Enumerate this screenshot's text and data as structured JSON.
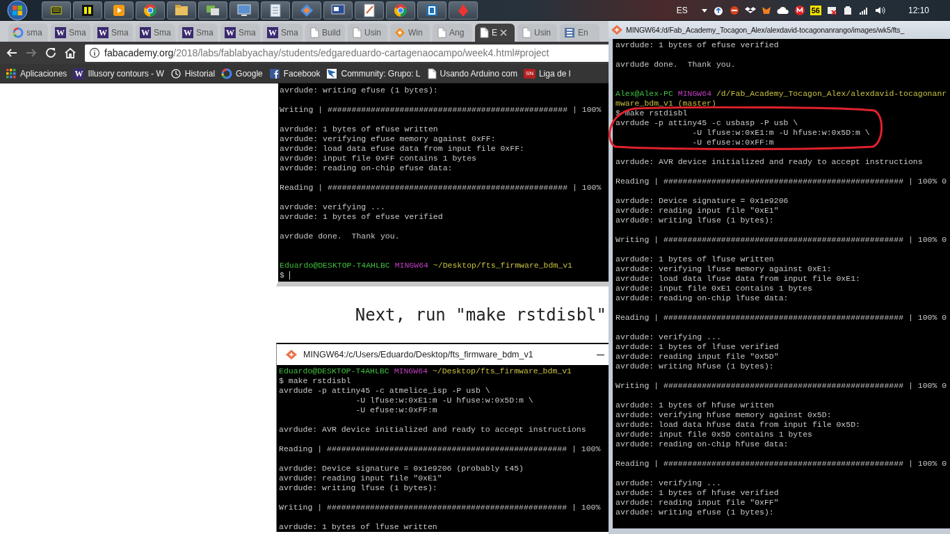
{
  "taskbar": {
    "language": "ES",
    "badge": "56",
    "clock": "12:10"
  },
  "browser": {
    "tabs": [
      {
        "kind": "google",
        "label": "sma",
        "selected": false
      },
      {
        "kind": "wiki",
        "icon_text": "W",
        "label": "Sma",
        "selected": false
      },
      {
        "kind": "wiki",
        "icon_text": "W",
        "label": "Sma",
        "selected": false
      },
      {
        "kind": "wiki",
        "icon_text": "W",
        "label": "Sma",
        "selected": false
      },
      {
        "kind": "wiki",
        "icon_text": "W",
        "label": "Sma",
        "selected": false
      },
      {
        "kind": "wiki",
        "icon_text": "W",
        "label": "Sma",
        "selected": false
      },
      {
        "kind": "wiki",
        "icon_text": "W",
        "label": "Sma",
        "selected": false
      },
      {
        "kind": "doc",
        "label": "Build",
        "selected": false
      },
      {
        "kind": "doc",
        "label": "Usin",
        "selected": false
      },
      {
        "kind": "diamond",
        "label": "Win",
        "selected": false
      },
      {
        "kind": "doc",
        "label": "Ang",
        "selected": false
      },
      {
        "kind": "doc",
        "label": "E",
        "selected": true
      },
      {
        "kind": "doc",
        "label": "Usin",
        "selected": false
      },
      {
        "kind": "lines",
        "label": "En",
        "selected": false
      }
    ],
    "address": {
      "host": "fabacademy.org",
      "path": "/2018/labs/fablabyachay/students/edgareduardo-cartagenaocampo/week4.html#project"
    },
    "bookmarks": [
      {
        "kind": "apps",
        "label": "Aplicaciones"
      },
      {
        "kind": "wiki",
        "icon_text": "W",
        "label": "Illusory contours - W"
      },
      {
        "kind": "history",
        "label": "Historial"
      },
      {
        "kind": "google",
        "label": "Google"
      },
      {
        "kind": "facebook",
        "label": "Facebook"
      },
      {
        "kind": "star",
        "label": "Community: Grupo: L"
      },
      {
        "kind": "doc",
        "label": "Usando Arduino com"
      },
      {
        "kind": "badge",
        "icon_text": "SN",
        "label": "Liga de l"
      }
    ]
  },
  "page": {
    "terminal_top": {
      "lines": [
        {
          "kind": "text",
          "text": "avrdude: writing efuse (1 bytes):"
        },
        {
          "kind": "blank"
        },
        {
          "kind": "text",
          "text": "Writing | ################################################## | 100%"
        },
        {
          "kind": "blank"
        },
        {
          "kind": "text",
          "text": "avrdude: 1 bytes of efuse written"
        },
        {
          "kind": "text",
          "text": "avrdude: verifying efuse memory against 0xFF:"
        },
        {
          "kind": "text",
          "text": "avrdude: load data efuse data from input file 0xFF:"
        },
        {
          "kind": "text",
          "text": "avrdude: input file 0xFF contains 1 bytes"
        },
        {
          "kind": "text",
          "text": "avrdude: reading on-chip efuse data:"
        },
        {
          "kind": "blank"
        },
        {
          "kind": "text",
          "text": "Reading | ################################################## | 100%"
        },
        {
          "kind": "blank"
        },
        {
          "kind": "text",
          "text": "avrdude: verifying ..."
        },
        {
          "kind": "text",
          "text": "avrdude: 1 bytes of efuse verified"
        },
        {
          "kind": "blank"
        },
        {
          "kind": "text",
          "text": "avrdude done.  Thank you."
        },
        {
          "kind": "blank"
        },
        {
          "kind": "blank"
        },
        {
          "kind": "prompt",
          "user": "Eduardo@DESKTOP-T4AHLBC",
          "shell": "MINGW64",
          "path": "~/Desktop/fts_firmware_bdm_v1"
        },
        {
          "kind": "cursor",
          "text": "$"
        }
      ]
    },
    "heading": "Next, run \"make rstdisbl\"",
    "terminal_bottom": {
      "title": "MINGW64:/c/Users/Eduardo/Desktop/fts_firmware_bdm_v1",
      "lines": [
        {
          "kind": "prompt",
          "user": "Eduardo@DESKTOP-T4AHLBC",
          "shell": "MINGW64",
          "path": "~/Desktop/fts_firmware_bdm_v1"
        },
        {
          "kind": "text",
          "text": "$ make rstdisbl"
        },
        {
          "kind": "text",
          "text": "avrdude -p attiny45 -c atmelice_isp -P usb \\"
        },
        {
          "kind": "text",
          "text": "                -U lfuse:w:0xE1:m -U hfuse:w:0x5D:m \\"
        },
        {
          "kind": "text",
          "text": "                -U efuse:w:0xFF:m"
        },
        {
          "kind": "blank"
        },
        {
          "kind": "text",
          "text": "avrdude: AVR device initialized and ready to accept instructions"
        },
        {
          "kind": "blank"
        },
        {
          "kind": "text",
          "text": "Reading | ################################################## | 100%"
        },
        {
          "kind": "blank"
        },
        {
          "kind": "text",
          "text": "avrdude: Device signature = 0x1e9206 (probably t45)"
        },
        {
          "kind": "text",
          "text": "avrdude: reading input file \"0xE1\""
        },
        {
          "kind": "text",
          "text": "avrdude: writing lfuse (1 bytes):"
        },
        {
          "kind": "blank"
        },
        {
          "kind": "text",
          "text": "Writing | ################################################## | 100%"
        },
        {
          "kind": "blank"
        },
        {
          "kind": "text",
          "text": "avrdude: 1 bytes of lfuse written"
        }
      ]
    }
  },
  "terminal_window": {
    "title": "MINGW64:/d/Fab_Academy_Tocagon_Alex/alexdavid-tocagonanrango/images/wk5/fts_",
    "lines": [
      {
        "kind": "text",
        "text": "avrdude: 1 bytes of efuse verified"
      },
      {
        "kind": "blank"
      },
      {
        "kind": "text",
        "text": "avrdude done.  Thank you."
      },
      {
        "kind": "blank"
      },
      {
        "kind": "blank"
      },
      {
        "kind": "prompt",
        "user": "Alex@Alex-PC",
        "shell": "MINGW64",
        "path": "/d/Fab_Academy_Tocagon_Alex/alexdavid-tocagonanr"
      },
      {
        "kind": "path",
        "text": "mware_bdm_v1 (master)"
      },
      {
        "kind": "group",
        "highlighted": true,
        "lines": [
          {
            "kind": "text",
            "text": "$ make rstdisbl"
          },
          {
            "kind": "text",
            "text": "avrdude -p attiny45 -c usbasp -P usb \\"
          },
          {
            "kind": "text",
            "text": "                -U lfuse:w:0xE1:m -U hfuse:w:0x5D:m \\"
          },
          {
            "kind": "text",
            "text": "                -U efuse:w:0xFF:m"
          }
        ]
      },
      {
        "kind": "blank"
      },
      {
        "kind": "text",
        "text": "avrdude: AVR device initialized and ready to accept instructions"
      },
      {
        "kind": "blank"
      },
      {
        "kind": "text",
        "text": "Reading | ################################################## | 100% 0"
      },
      {
        "kind": "blank"
      },
      {
        "kind": "text",
        "text": "avrdude: Device signature = 0x1e9206"
      },
      {
        "kind": "text",
        "text": "avrdude: reading input file \"0xE1\""
      },
      {
        "kind": "text",
        "text": "avrdude: writing lfuse (1 bytes):"
      },
      {
        "kind": "blank"
      },
      {
        "kind": "text",
        "text": "Writing | ################################################## | 100% 0"
      },
      {
        "kind": "blank"
      },
      {
        "kind": "text",
        "text": "avrdude: 1 bytes of lfuse written"
      },
      {
        "kind": "text",
        "text": "avrdude: verifying lfuse memory against 0xE1:"
      },
      {
        "kind": "text",
        "text": "avrdude: load data lfuse data from input file 0xE1:"
      },
      {
        "kind": "text",
        "text": "avrdude: input file 0xE1 contains 1 bytes"
      },
      {
        "kind": "text",
        "text": "avrdude: reading on-chip lfuse data:"
      },
      {
        "kind": "blank"
      },
      {
        "kind": "text",
        "text": "Reading | ################################################## | 100% 0"
      },
      {
        "kind": "blank"
      },
      {
        "kind": "text",
        "text": "avrdude: verifying ..."
      },
      {
        "kind": "text",
        "text": "avrdude: 1 bytes of lfuse verified"
      },
      {
        "kind": "text",
        "text": "avrdude: reading input file \"0x5D\""
      },
      {
        "kind": "text",
        "text": "avrdude: writing hfuse (1 bytes):"
      },
      {
        "kind": "blank"
      },
      {
        "kind": "text",
        "text": "Writing | ################################################## | 100% 0"
      },
      {
        "kind": "blank"
      },
      {
        "kind": "text",
        "text": "avrdude: 1 bytes of hfuse written"
      },
      {
        "kind": "text",
        "text": "avrdude: verifying hfuse memory against 0x5D:"
      },
      {
        "kind": "text",
        "text": "avrdude: load data hfuse data from input file 0x5D:"
      },
      {
        "kind": "text",
        "text": "avrdude: input file 0x5D contains 1 bytes"
      },
      {
        "kind": "text",
        "text": "avrdude: reading on-chip hfuse data:"
      },
      {
        "kind": "blank"
      },
      {
        "kind": "text",
        "text": "Reading | ################################################## | 100% 0"
      },
      {
        "kind": "blank"
      },
      {
        "kind": "text",
        "text": "avrdude: verifying ..."
      },
      {
        "kind": "text",
        "text": "avrdude: 1 bytes of hfuse verified"
      },
      {
        "kind": "text",
        "text": "avrdude: reading input file \"0xFF\""
      },
      {
        "kind": "text",
        "text": "avrdude: writing efuse (1 bytes):"
      }
    ]
  }
}
